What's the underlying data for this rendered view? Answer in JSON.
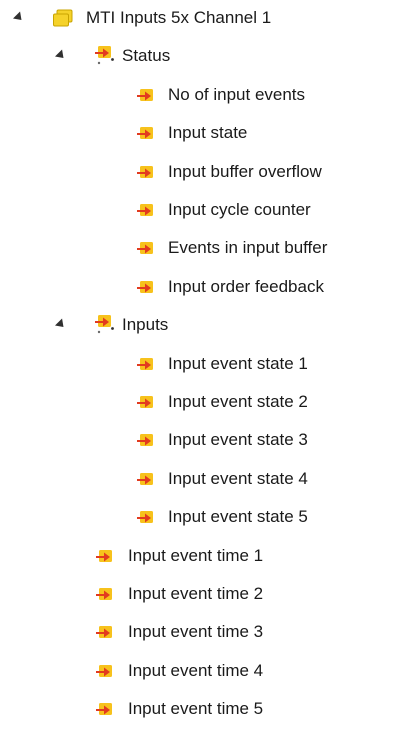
{
  "tree": {
    "root": {
      "label": "MTI Inputs 5x Channel 1",
      "icon": "module-folder-icon",
      "expanded": true
    },
    "groups": [
      {
        "key": "status",
        "label": "Status",
        "icon": "input-group-icon",
        "expanded": true,
        "items": [
          {
            "label": "No of input events",
            "icon": "input-variable-icon"
          },
          {
            "label": "Input state",
            "icon": "input-variable-icon"
          },
          {
            "label": "Input buffer overflow",
            "icon": "input-variable-icon"
          },
          {
            "label": "Input cycle counter",
            "icon": "input-variable-icon"
          },
          {
            "label": "Events in input buffer",
            "icon": "input-variable-icon"
          },
          {
            "label": "Input order feedback",
            "icon": "input-variable-icon"
          }
        ]
      },
      {
        "key": "inputs",
        "label": "Inputs",
        "icon": "input-group-icon",
        "expanded": true,
        "items": [
          {
            "label": "Input event state 1",
            "icon": "input-variable-icon"
          },
          {
            "label": "Input event state 2",
            "icon": "input-variable-icon"
          },
          {
            "label": "Input event state 3",
            "icon": "input-variable-icon"
          },
          {
            "label": "Input event state 4",
            "icon": "input-variable-icon"
          },
          {
            "label": "Input event state 5",
            "icon": "input-variable-icon"
          }
        ]
      }
    ],
    "root_items": [
      {
        "label": "Input event time 1",
        "icon": "input-variable-icon"
      },
      {
        "label": "Input event time 2",
        "icon": "input-variable-icon"
      },
      {
        "label": "Input event time 3",
        "icon": "input-variable-icon"
      },
      {
        "label": "Input event time 4",
        "icon": "input-variable-icon"
      },
      {
        "label": "Input event time 5",
        "icon": "input-variable-icon"
      }
    ]
  },
  "colors": {
    "folder_fill": "#f5d22a",
    "folder_stroke": "#c9a400",
    "variable_fill": "#f7c21c",
    "variable_arrow": "#e23b1f",
    "text": "#1a1a1a"
  }
}
